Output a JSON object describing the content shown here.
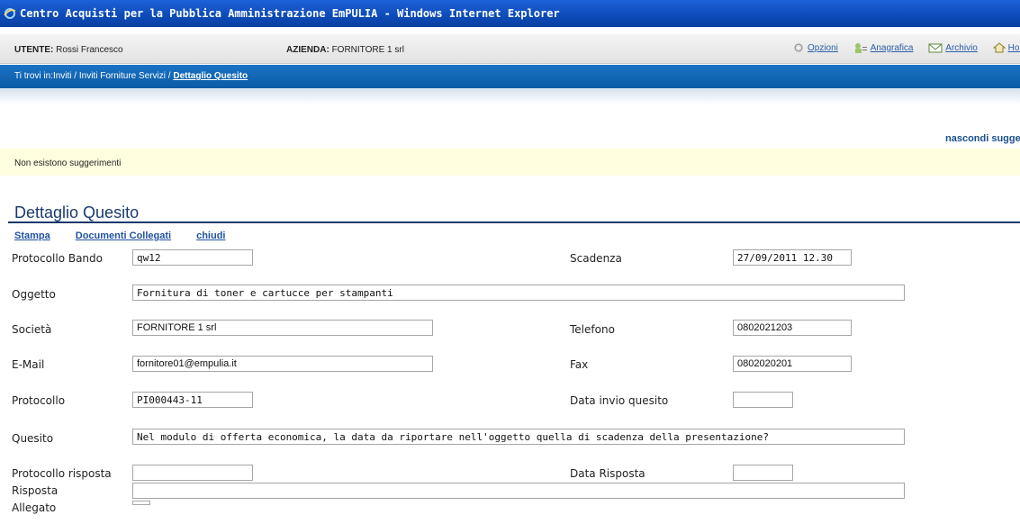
{
  "window": {
    "title": "Centro Acquisti per la Pubblica Amministrazione EmPULIA - Windows Internet Explorer"
  },
  "userbar": {
    "user_label": "UTENTE:",
    "user_value": "Rossi Francesco",
    "company_label": "AZIENDA:",
    "company_value": "FORNITORE 1 srl",
    "links": [
      "Opzioni",
      "Anagrafica",
      "Archivio",
      "Home"
    ]
  },
  "breadcrumb": {
    "prefix": "Ti trovi in:Inviti / Inviti Forniture Servizi / ",
    "current": "Dettaglio Quesito"
  },
  "suggestions": {
    "hide_link": "nascondi suggerimenti",
    "message": "Non esistono suggerimenti"
  },
  "page": {
    "title": "Dettaglio Quesito"
  },
  "actions": [
    "Stampa",
    "Documenti Collegati",
    "chiudi"
  ],
  "form": {
    "protocollo_bando": {
      "label": "Protocollo Bando",
      "value": "qw12"
    },
    "scadenza": {
      "label": "Scadenza",
      "value": "27/09/2011 12.30"
    },
    "oggetto": {
      "label": "Oggetto",
      "value": "Fornitura di toner e cartucce per stampanti"
    },
    "societa": {
      "label": "Società",
      "value": "FORNITORE 1 srl"
    },
    "telefono": {
      "label": "Telefono",
      "value": "0802021203"
    },
    "email": {
      "label": "E-Mail",
      "value": "fornitore01@empulia.it"
    },
    "fax": {
      "label": "Fax",
      "value": "0802020201"
    },
    "protocollo": {
      "label": "Protocollo",
      "value": "PI000443-11"
    },
    "data_invio": {
      "label": "Data invio quesito",
      "value": ""
    },
    "quesito": {
      "label": "Quesito",
      "value": "Nel modulo di offerta economica, la data da riportare nell'oggetto quella di scadenza della presentazione?"
    },
    "protocollo_risposta": {
      "label": "Protocollo risposta",
      "value": ""
    },
    "data_risposta": {
      "label": "Data Risposta",
      "value": ""
    },
    "risposta": {
      "label": "Risposta",
      "value": ""
    },
    "allegato": {
      "label": "Allegato",
      "value": ""
    }
  }
}
